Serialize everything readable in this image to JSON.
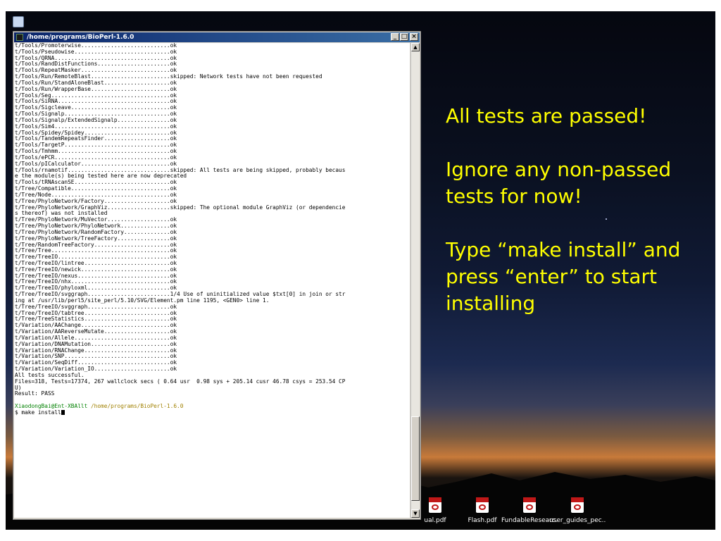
{
  "window": {
    "title": "/home/programs/BioPerl-1.6.0",
    "minimize_label": "_",
    "maximize_label": "□",
    "close_label": "×"
  },
  "terminal": {
    "lines": [
      "t/Tools/Promoterwise...........................ok",
      "t/Tools/Pseudowise.............................ok",
      "t/Tools/QRNA...................................ok",
      "t/Tools/RandDistFunctions......................ok",
      "t/Tools/RepeatMasker...........................ok",
      "t/Tools/Run/RemoteBlast........................skipped: Network tests have not been requested",
      "t/Tools/Run/StandAloneBlast....................ok",
      "t/Tools/Run/WrapperBase........................ok",
      "t/Tools/Seg....................................ok",
      "t/Tools/SiRNA..................................ok",
      "t/Tools/Sigcleave..............................ok",
      "t/Tools/Signalp................................ok",
      "t/Tools/Signalp/ExtendedSignalp................ok",
      "t/Tools/Sim4...................................ok",
      "t/Tools/Spidey/Spidey..........................ok",
      "t/Tools/TandemRepeatsFinder....................ok",
      "t/Tools/TargetP................................ok",
      "t/Tools/Tmhmm..................................ok",
      "t/Tools/ePCR...................................ok",
      "t/Tools/pICalculator...........................ok",
      "t/Tools/rnamotif...............................skipped: All tests are being skipped, probably becaus",
      "e the module(s) being tested here are now deprecated",
      "t/Tools/tRNAscanSE.............................ok",
      "t/Tree/Compatible..............................ok",
      "t/Tree/Node....................................ok",
      "t/Tree/PhyloNetwork/Factory....................ok",
      "t/Tree/PhyloNetwork/GraphViz...................skipped: The optional module GraphViz (or dependencie",
      "s thereof) was not installed",
      "t/Tree/PhyloNetwork/MuVector...................ok",
      "t/Tree/PhyloNetwork/PhyloNetwork...............ok",
      "t/Tree/PhyloNetwork/RandomFactory..............ok",
      "t/Tree/PhyloNetwork/TreeFactory................ok",
      "t/Tree/RandomTreeFactory.......................ok",
      "t/Tree/Tree....................................ok",
      "t/Tree/TreeIO..................................ok",
      "t/Tree/TreeIO/lintree..........................ok",
      "t/Tree/TreeIO/newick...........................ok",
      "t/Tree/TreeIO/nexus............................ok",
      "t/Tree/TreeIO/nhx..............................ok",
      "t/Tree/TreeIO/phyloxml.........................ok",
      "t/Tree/TreeIO/svggraph.........................1/4 Use of uninitialized value $txt[0] in join or str",
      "ing at /usr/lib/perl5/site_perl/5.10/SVG/Element.pm line 1195, <GEN0> line 1.",
      "t/Tree/TreeIO/svggraph.........................ok",
      "t/Tree/TreeIO/tabtree..........................ok",
      "t/Tree/TreeStatistics..........................ok",
      "t/Variation/AAChange...........................ok",
      "t/Variation/AAReverseMutate....................ok",
      "t/Variation/Allele.............................ok",
      "t/Variation/DNAMutation........................ok",
      "t/Variation/RNAChange..........................ok",
      "t/Variation/SNP................................ok",
      "t/Variation/SeqDiff............................ok",
      "t/Variation/Variation_IO.......................ok",
      "All tests successful.",
      "Files=318, Tests=17374, 267 wallclock secs ( 0.64 usr  0.98 sys + 205.14 cusr 46.78 csys = 253.54 CP",
      "U)",
      "Result: PASS"
    ],
    "prompt_user": "XiaodongBai@Ent-XBAllt",
    "prompt_path": "/home/programs/BioPerl-1.6.0",
    "command": "$ make install"
  },
  "slide": {
    "line1": "All tests are passed!",
    "line2": "Ignore any non-passed tests for now!",
    "line3": "Type “make install” and press “enter” to start installing",
    "text_color": "#ffff00"
  },
  "desktop_icons": [
    {
      "label": "ual.pdf",
      "icon": "pdf-icon"
    },
    {
      "label": "Flash.pdf",
      "icon": "pdf-icon"
    },
    {
      "label": "FundableResearc...",
      "icon": "pdf-icon"
    },
    {
      "label": "user_guides_pec...",
      "icon": "pdf-icon"
    }
  ]
}
